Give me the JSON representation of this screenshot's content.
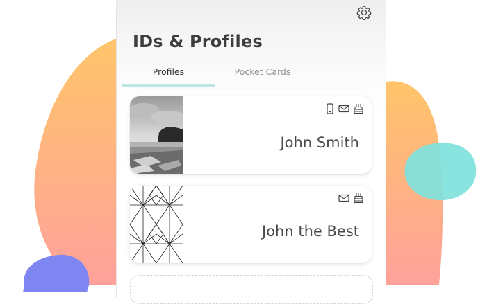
{
  "header": {
    "title": "IDs & Profiles",
    "settings_icon": "gear-icon"
  },
  "tabs": [
    {
      "label": "Profiles",
      "active": true
    },
    {
      "label": "Pocket Cards",
      "active": false
    }
  ],
  "profiles": [
    {
      "name": "John Smith",
      "image": "beach-photo",
      "icons": [
        "phone-icon",
        "mail-icon",
        "birthday-cake-icon"
      ]
    },
    {
      "name": "John the Best",
      "image": "geometric-pattern",
      "icons": [
        "mail-icon",
        "birthday-cake-icon"
      ]
    }
  ],
  "colors": {
    "accent_tab_underline": "#bfe6e2",
    "blob_orange_top": "#ffc36b",
    "blob_pink_bottom": "#ffa09a",
    "blob_teal": "#7fe1dc",
    "blob_blue": "#7f86f2"
  }
}
